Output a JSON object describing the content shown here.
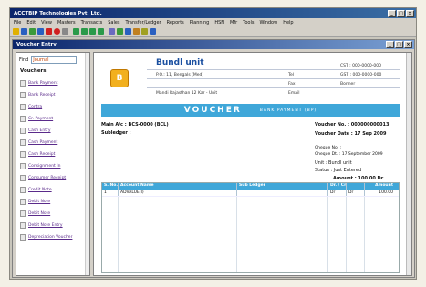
{
  "app": {
    "title": "ACCTBIP Technologies Pvt. Ltd.",
    "menu": [
      "File",
      "Edit",
      "View",
      "Masters",
      "Transacts",
      "Sales",
      "Transfer/Ledger",
      "Reports",
      "Planning",
      "HSN",
      "Mfr",
      "Tools",
      "Window",
      "Help"
    ]
  },
  "child": {
    "title": "Voucher Entry"
  },
  "sidebar": {
    "search_label": "Find",
    "search_value": "Journal",
    "heading": "Vouchers",
    "items": [
      "Bank Payment",
      "Bank Receipt",
      "Contra",
      "Cr. Payment",
      "Cash Entry",
      "Cash Payment",
      "Cash Receipt",
      "Consignment In",
      "Consumer Receipt",
      "Credit Note",
      "Debit Note",
      "Debit Note",
      "Debit Note Entry",
      "Depreciation Voucher"
    ]
  },
  "company": {
    "logo_glyph": "B",
    "name": "Bundl unit",
    "addr1": "P.O.: 11, Bengals (Med)",
    "addr2": "Mandi Rajasthan 12 Kar - Unit",
    "tel_label": "Tel",
    "fax_label": "Fax",
    "email_label": "Email",
    "tel1": "CST : 000-0000-000",
    "tel2": "GST : 000-0000-000",
    "fax": "Bonner"
  },
  "voucher": {
    "title": "VOUCHER",
    "subtitle": "BANK PAYMENT (BP)",
    "main_ac": "Main A/c : BCS-0000 (BCL)",
    "sub_ledger": "Subledger :",
    "voucher_no": "Voucher No. : 000000000013",
    "voucher_date": "Voucher Date : 17 Sep 2009",
    "cheque_no": "Cheque No. :",
    "cheque_date": "Cheque Dt. : 17 September 2009",
    "unit": "Unit : Bundl unit",
    "status": "Status : Just Entered",
    "amount": "Amount : 100.00 Dr."
  },
  "grid": {
    "headers": [
      "S. No.",
      "Account Name",
      "Sub Ledger",
      "Dr. / Cr.",
      "",
      "Amount"
    ],
    "rows": [
      [
        "1",
        "ADVALUE(I)",
        "",
        "Dr",
        "Dr",
        "100.00"
      ]
    ]
  }
}
